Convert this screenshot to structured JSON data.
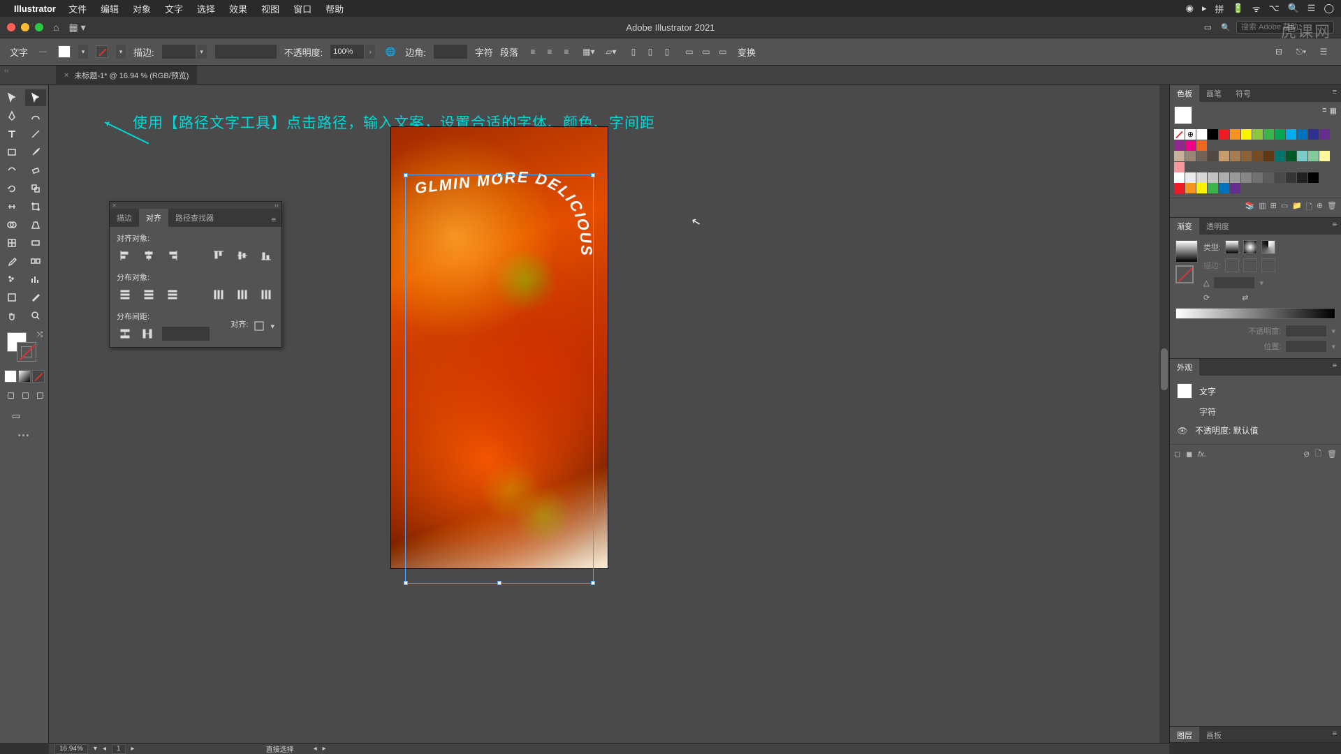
{
  "mac_menu": {
    "app": "Illustrator",
    "items": [
      "文件",
      "编辑",
      "对象",
      "文字",
      "选择",
      "效果",
      "视图",
      "窗口",
      "帮助"
    ]
  },
  "titlebar": {
    "title": "Adobe Illustrator 2021",
    "search_placeholder": "搜索 Adobe 帮助"
  },
  "control_bar": {
    "mode_label": "文字",
    "stroke_label": "描边:",
    "stroke_value": "",
    "opacity_label": "不透明度:",
    "opacity_value": "100%",
    "corner_label": "边角:",
    "corner_value": "",
    "char_label": "字符",
    "para_label": "段落",
    "transform_label": "变换"
  },
  "document": {
    "tab_label": "未标题-1* @ 16.94 % (RGB/预览)"
  },
  "annotation": {
    "text": "使用【路径文字工具】点击路径，输入文案，设置合适的字体、颜色、字间距"
  },
  "artwork": {
    "path_text": "GLMIN MORE DELICIOUS"
  },
  "align_panel": {
    "tab_stroke": "描边",
    "tab_align": "对齐",
    "tab_pathfinder": "路径查找器",
    "section_align": "对齐对象:",
    "section_distribute": "分布对象:",
    "section_spacing": "分布间距:",
    "align_to_label": "对齐:",
    "spacing_value": ""
  },
  "swatches": {
    "tab_swatches": "色板",
    "tab_brushes": "画笔",
    "tab_symbols": "符号",
    "colors_row1": [
      "#ffffff",
      "#000000",
      "#ed1c24",
      "#f7941d",
      "#fff200",
      "#8dc63f",
      "#39b54a",
      "#00a651",
      "#00aeef",
      "#0072bc",
      "#2e3192",
      "#662d91",
      "#92278f",
      "#ec008c",
      "#f26522"
    ],
    "colors_row2": [
      "#c7b299",
      "#998675",
      "#736357",
      "#534741",
      "#c69c6d",
      "#a67c52",
      "#8c6239",
      "#754c24",
      "#603913",
      "#00746b",
      "#005826",
      "#7accc8",
      "#82ca9c",
      "#fff799",
      "#f5989d"
    ],
    "colors_row3": [
      "#ffffff",
      "#ebebeb",
      "#d7d7d7",
      "#c2c2c2",
      "#aeaeae",
      "#9a9a9a",
      "#868686",
      "#717171",
      "#5d5d5d",
      "#494949",
      "#353535",
      "#212121",
      "#000000"
    ],
    "colors_row4": [
      "#ed1c24",
      "#f7941d",
      "#fff200",
      "#39b54a",
      "#0072bc",
      "#662d91"
    ]
  },
  "gradient": {
    "tab_gradient": "渐变",
    "tab_transparency": "透明度",
    "type_label": "类型:",
    "stroke_label": "描边:",
    "angle_value": "",
    "opacity_label": "不透明度:",
    "opacity_value": "",
    "location_label": "位置:",
    "location_value": ""
  },
  "appearance": {
    "tab_label": "外观",
    "object_label": "文字",
    "char_label": "字符",
    "opacity_row": "不透明度: 默认值"
  },
  "layers": {
    "tab_layers": "图层",
    "tab_artboards": "画板"
  },
  "status": {
    "zoom": "16.94%",
    "artboard_nav": "1",
    "tool_hint": "直接选择"
  },
  "watermark": "虎课网"
}
